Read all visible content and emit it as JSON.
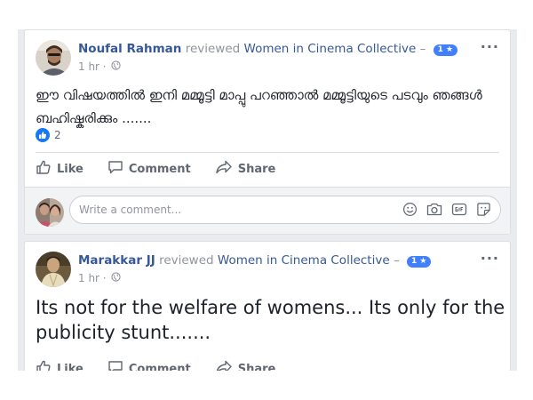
{
  "posts": [
    {
      "author": "Noufal Rahman",
      "verb": "reviewed",
      "page": "Women in Cinema Collective",
      "dash": "–",
      "rating": "1 ★",
      "time": "1 hr ·",
      "more": "···",
      "text": "ഈ വിഷയത്തിൽ ഇനി മമ്മൂട്ടി മാപ്പു പറഞ്ഞാൽ മമ്മൂട്ടിയുടെ പടവും ഞങ്ങൾ ബഹിഷ്കരിക്കും .......",
      "like_count": "2",
      "actions": {
        "like": "Like",
        "comment": "Comment",
        "share": "Share"
      },
      "comment_placeholder": "Write a comment..."
    },
    {
      "author": "Marakkar JJ",
      "verb": "reviewed",
      "page": "Women in Cinema Collective",
      "dash": "–",
      "rating": "1 ★",
      "time": "1 hr ·",
      "more": "···",
      "text": "Its not for the welfare of womens... Its only for the publicity stunt.......",
      "actions": {
        "like": "Like",
        "comment": "Comment",
        "share": "Share"
      }
    }
  ],
  "icons": {
    "globe": "globe-icon",
    "like": "thumbs-up-icon",
    "comment": "speech-bubble-icon",
    "share": "share-arrow-icon",
    "emoji": "emoji-icon",
    "camera": "camera-icon",
    "gif": "gif-icon",
    "sticker": "sticker-icon"
  },
  "colors": {
    "link": "#365899",
    "meta": "#90949c",
    "badge": "#4080ff",
    "like": "#1877f2",
    "feed_bg": "#e9ebee"
  }
}
